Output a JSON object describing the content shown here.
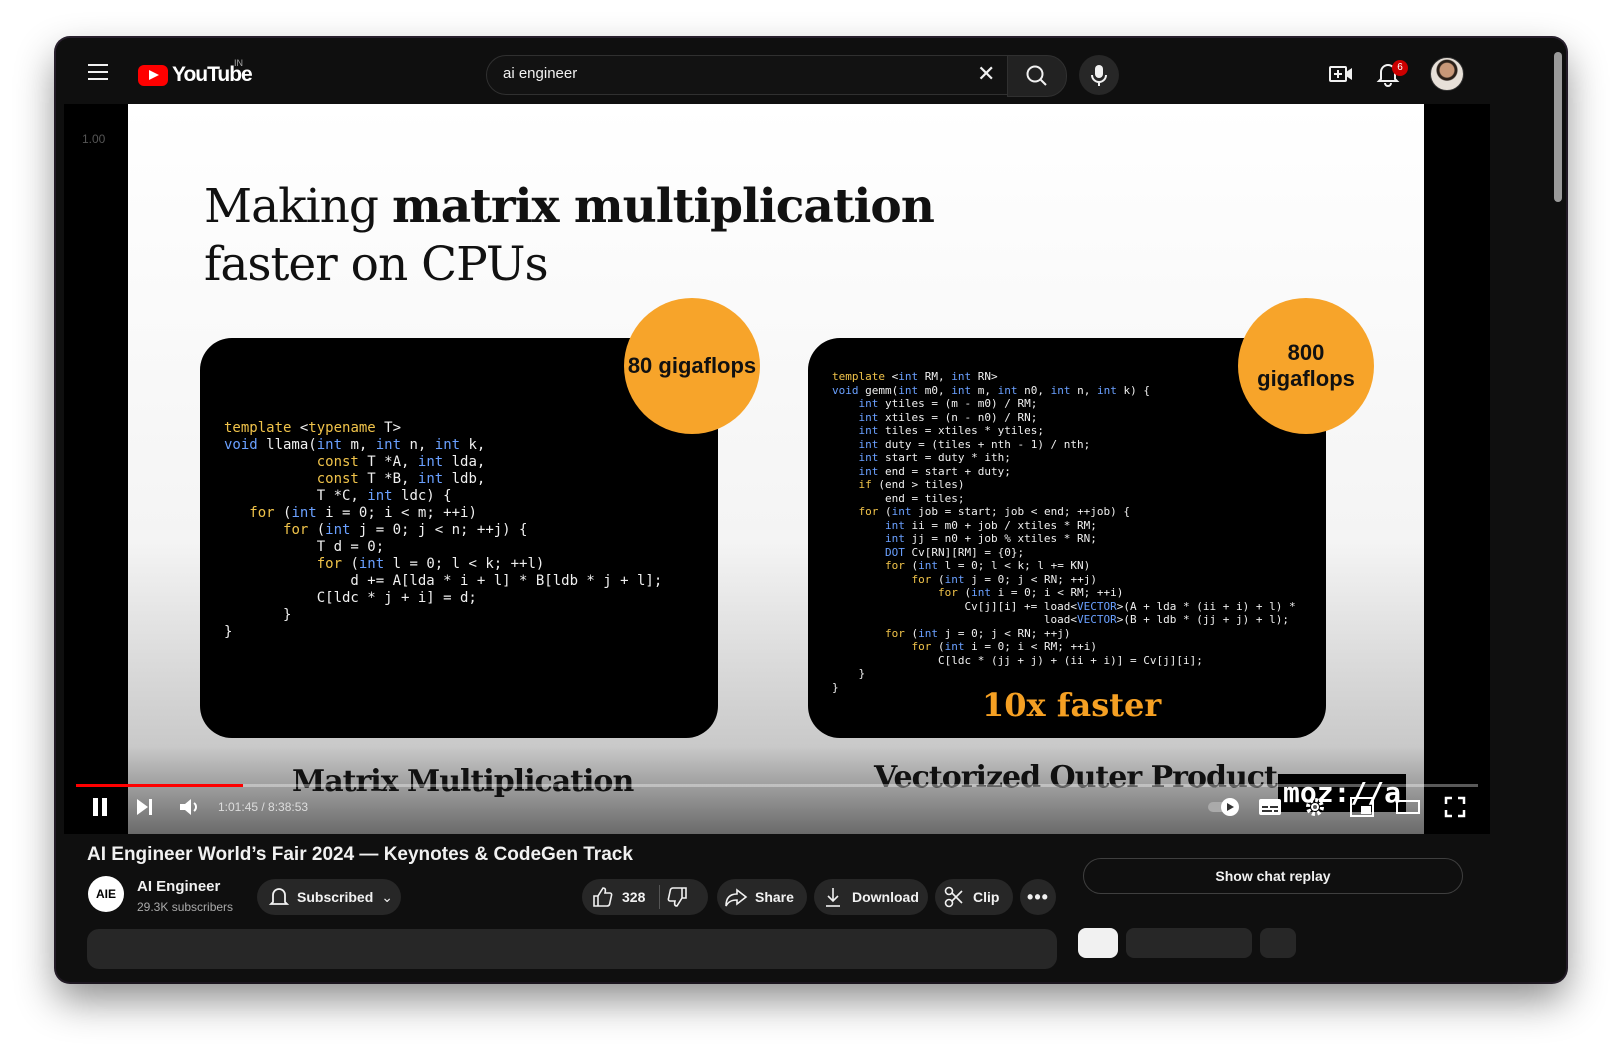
{
  "header": {
    "logo_text": "YouTube",
    "region": "IN",
    "search_value": "ai engineer",
    "notifications_count": "6"
  },
  "player": {
    "speed_label": "1.00",
    "time_display": "1:01:45 / 8:38:53",
    "progress_fraction": 0.119,
    "slide": {
      "title_prefix": "Making ",
      "title_bold": "matrix multiplication",
      "title_line2": "faster on CPUs",
      "left_badge": "80 gigaflops",
      "right_badge": "800 gigaflops",
      "faster": "10x faster",
      "left_caption": "Matrix Multiplication",
      "right_caption": "Vectorized Outer Product",
      "watermark": "moz://a"
    }
  },
  "video": {
    "title": "AI Engineer World’s Fair 2024 — Keynotes & CodeGen Track",
    "channel_logo": "AIE",
    "channel_name": "AI Engineer",
    "subscribers": "29.3K subscribers",
    "subscribe_label": "Subscribed",
    "likes": "328",
    "share_label": "Share",
    "download_label": "Download",
    "clip_label": "Clip",
    "chat_replay_label": "Show chat replay"
  },
  "colors": {
    "brand_red": "#ff0000",
    "badge_orange": "#f7a42a",
    "background": "#0f0f0f"
  }
}
